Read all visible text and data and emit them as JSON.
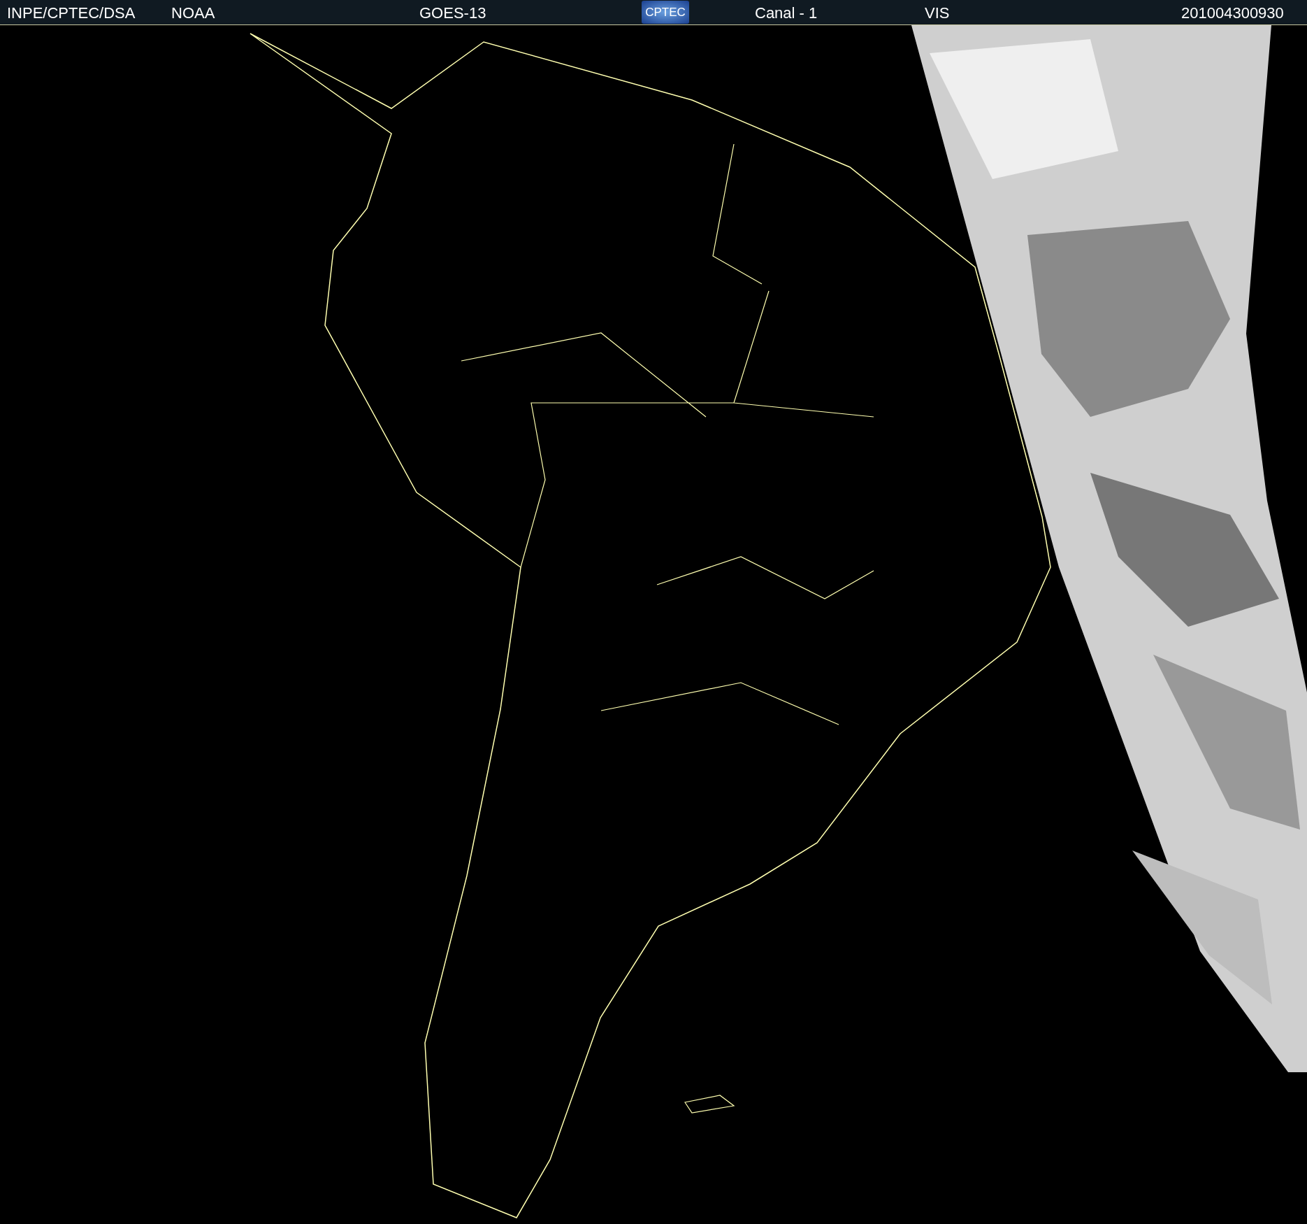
{
  "header": {
    "items": [
      {
        "kind": "text",
        "text": "INPE/CPTEC/DSA"
      },
      {
        "kind": "text",
        "text": "NOAA"
      },
      {
        "kind": "text",
        "text": "GOES-13"
      },
      {
        "kind": "logo",
        "text": "CPTEC"
      },
      {
        "kind": "text",
        "text": "Canal - 1"
      },
      {
        "kind": "text",
        "text": "VIS"
      },
      {
        "kind": "text",
        "text": "201004300930"
      }
    ]
  }
}
